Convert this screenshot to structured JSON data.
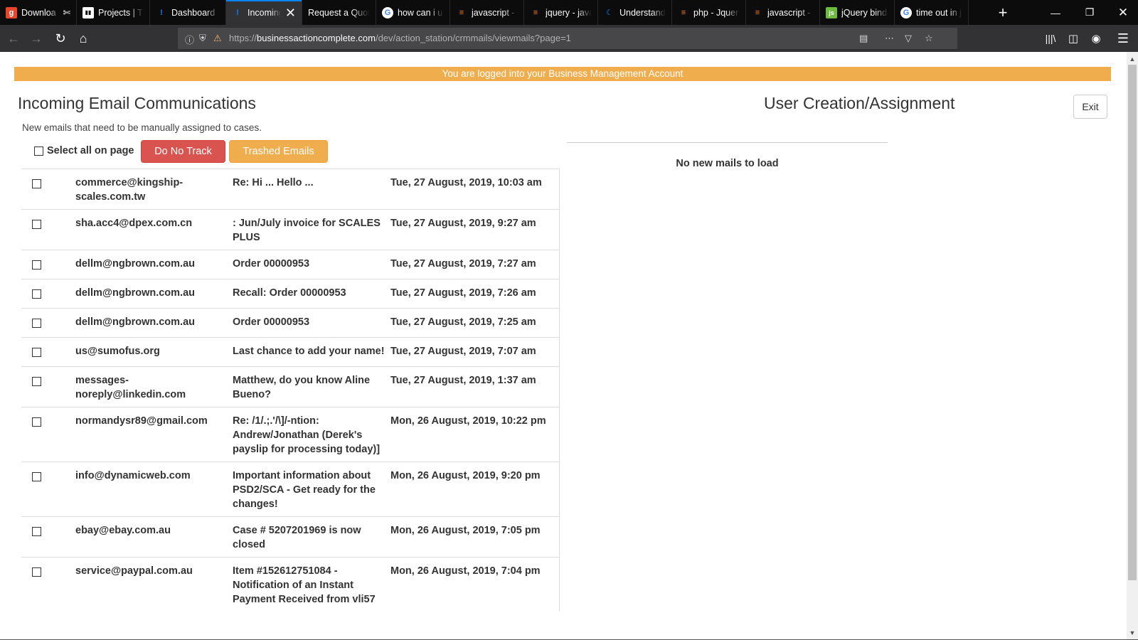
{
  "browser": {
    "tabs": [
      {
        "title": "Downloa",
        "favicon": "g-icon",
        "fav_glyph": "g",
        "fav_bg": "#e8462c",
        "extra": "✄"
      },
      {
        "title": "Projects | Tr",
        "favicon": "trello-icon",
        "fav_glyph": "▮▮",
        "fav_bg": "#ffffff"
      },
      {
        "title": "Dashboard",
        "favicon": "exclamation-icon",
        "fav_glyph": "!",
        "fav_bg": "transparent"
      },
      {
        "title": "Incoming",
        "favicon": "exclamation-icon",
        "fav_glyph": "!",
        "fav_bg": "transparent",
        "active": true
      },
      {
        "title": "Request a Quote",
        "favicon": "none",
        "fav_glyph": "",
        "fav_bg": "transparent"
      },
      {
        "title": "how can i u",
        "favicon": "google-icon",
        "fav_glyph": "G",
        "fav_bg": "#ffffff"
      },
      {
        "title": "javascript - d",
        "favicon": "stackoverflow-icon",
        "fav_glyph": "≡",
        "fav_bg": "transparent"
      },
      {
        "title": "jquery - java",
        "favicon": "stackoverflow-icon",
        "fav_glyph": "≡",
        "fav_bg": "transparent"
      },
      {
        "title": "Understandi",
        "favicon": "crescent-icon",
        "fav_glyph": "☾",
        "fav_bg": "transparent"
      },
      {
        "title": "php - Jquery",
        "favicon": "stackoverflow-icon",
        "fav_glyph": "≡",
        "fav_bg": "transparent"
      },
      {
        "title": "javascript - j",
        "favicon": "stackoverflow-icon",
        "fav_glyph": "≡",
        "fav_bg": "transparent"
      },
      {
        "title": "jQuery bind",
        "favicon": "jsfiddle-icon",
        "fav_glyph": "js",
        "fav_bg": "#6cbb3c"
      },
      {
        "title": "time out in j",
        "favicon": "google-icon",
        "fav_glyph": "G",
        "fav_bg": "#ffffff"
      }
    ],
    "url_prefix": "https://",
    "url_domain": "businessactioncomplete.com",
    "url_path": "/dev/action_station/crmmails/viewmails?page=1"
  },
  "page": {
    "banner": "You are logged into your Business Management Account",
    "left_heading": "Incoming Email Communications",
    "right_heading": "User Creation/Assignment",
    "exit_label": "Exit",
    "subtitle": "New emails that need to be manually assigned to cases.",
    "select_all_label": "Select all on page",
    "do_not_track_label": "Do No Track",
    "trashed_label": "Trashed Emails",
    "no_mails_text": "No new mails to load"
  },
  "emails": [
    {
      "from": "commerce@kingship-scales.com.tw",
      "subject": "Re: Hi ... Hello ...",
      "date": "Tue, 27 August, 2019, 10:03 am"
    },
    {
      "from": "sha.acc4@dpex.com.cn",
      "subject": ": Jun/July invoice for SCALES PLUS",
      "date": "Tue, 27 August, 2019, 9:27 am"
    },
    {
      "from": "dellm@ngbrown.com.au",
      "subject": "Order 00000953",
      "date": "Tue, 27 August, 2019, 7:27 am"
    },
    {
      "from": "dellm@ngbrown.com.au",
      "subject": "Recall: Order 00000953",
      "date": "Tue, 27 August, 2019, 7:26 am"
    },
    {
      "from": "dellm@ngbrown.com.au",
      "subject": "Order 00000953",
      "date": "Tue, 27 August, 2019, 7:25 am"
    },
    {
      "from": "us@sumofus.org",
      "subject": "Last chance to add your name!",
      "date": "Tue, 27 August, 2019, 7:07 am"
    },
    {
      "from": "messages-noreply@linkedin.com",
      "subject": "Matthew, do you know Aline Bueno?",
      "date": "Tue, 27 August, 2019, 1:37 am"
    },
    {
      "from": "normandysr89@gmail.com",
      "subject": "Re: /1/.;.'/\\]/-ntion: Andrew/Jonathan (Derek's payslip for processing today)]",
      "date": "Mon, 26 August, 2019, 10:22 pm"
    },
    {
      "from": "info@dynamicweb.com",
      "subject": "Important information about PSD2/SCA - Get ready for the changes!",
      "date": "Mon, 26 August, 2019, 9:20 pm"
    },
    {
      "from": "ebay@ebay.com.au",
      "subject": "Case # 5207201969 is now closed",
      "date": "Mon, 26 August, 2019, 7:05 pm"
    },
    {
      "from": "service@paypal.com.au",
      "subject": "Item #152612751084 - Notification of an Instant Payment Received from vli57",
      "date": "Mon, 26 August, 2019, 7:04 pm"
    }
  ]
}
